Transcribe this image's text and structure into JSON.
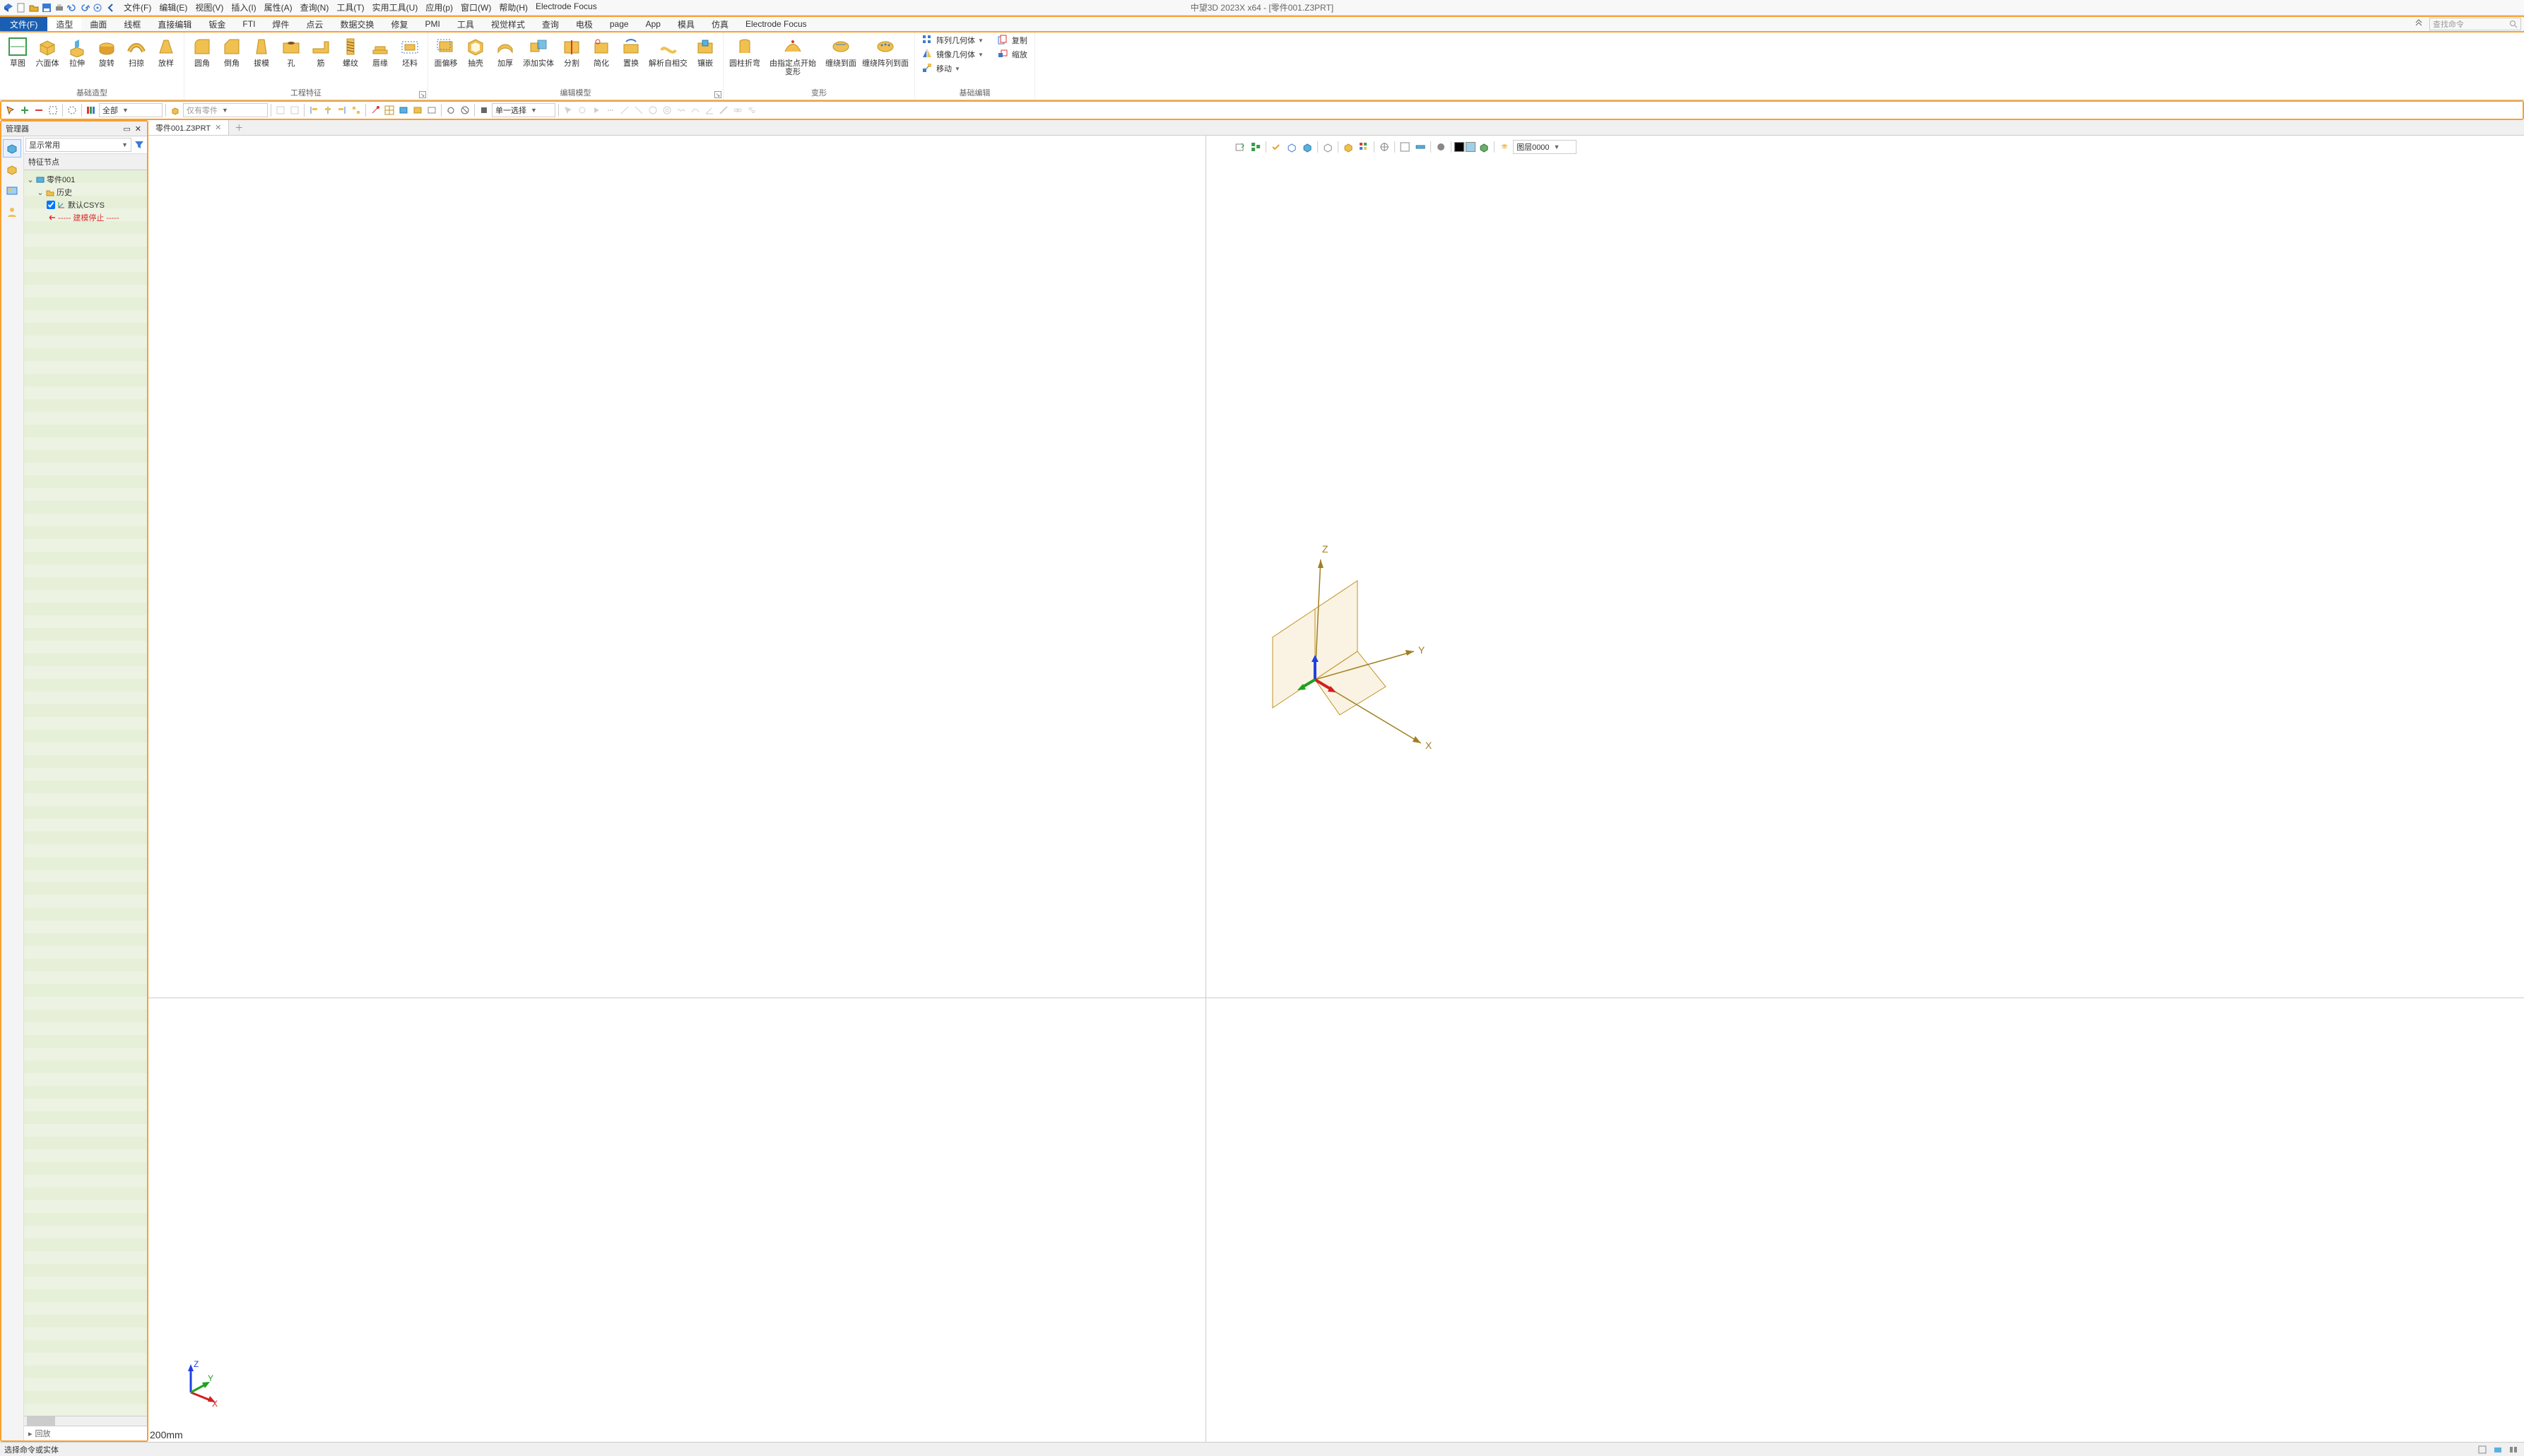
{
  "titlebar": {
    "app_title": "中望3D 2023X x64 - [零件001.Z3PRT]",
    "menus": [
      "文件(F)",
      "编辑(E)",
      "视图(V)",
      "插入(I)",
      "属性(A)",
      "查询(N)",
      "工具(T)",
      "实用工具(U)",
      "应用(p)",
      "窗口(W)",
      "帮助(H)",
      "Electrode Focus"
    ]
  },
  "ribbon": {
    "file_tab": "文件(F)",
    "tabs": [
      "造型",
      "曲面",
      "线框",
      "直接编辑",
      "钣金",
      "FTI",
      "焊件",
      "点云",
      "数据交换",
      "修复",
      "PMI",
      "工具",
      "视觉样式",
      "查询",
      "电极",
      "page",
      "App",
      "模具",
      "仿真",
      "Electrode Focus"
    ],
    "search_placeholder": "查找命令",
    "groups": {
      "shape": {
        "label": "基础造型",
        "buttons": [
          "草图",
          "六面体",
          "拉伸",
          "旋转",
          "扫掠",
          "放样"
        ]
      },
      "feature": {
        "label": "工程特征",
        "buttons": [
          "圆角",
          "倒角",
          "拔模",
          "孔",
          "筋",
          "螺纹",
          "唇缘",
          "坯料"
        ]
      },
      "edit": {
        "label": "编辑模型",
        "buttons": [
          "面偏移",
          "抽壳",
          "加厚",
          "添加实体",
          "分割",
          "简化",
          "置换",
          "解析自相交",
          "镶嵌"
        ]
      },
      "deform": {
        "label": "变形",
        "buttons": [
          "圆柱折弯",
          "由指定点开始变形",
          "缠绕到面",
          "缠绕阵列到面"
        ]
      },
      "basic_edit": {
        "label": "基础编辑",
        "rows": [
          [
            "阵列几何体",
            "复制"
          ],
          [
            "镜像几何体",
            "缩放"
          ],
          [
            "移动",
            ""
          ]
        ]
      }
    }
  },
  "toolbar2": {
    "filter1": "全部",
    "filter2": "仅有零件",
    "select_mode": "单一选择"
  },
  "left_panel": {
    "title": "管理器",
    "display_combo": "显示常用",
    "tree_header": "特征节点",
    "tree": {
      "root": "零件001",
      "history": "历史",
      "csys": "默认CSYS",
      "stop": "----- 建模停止 -----"
    },
    "playback": "回放"
  },
  "viewport": {
    "doc_tab": "零件001.Z3PRT",
    "layer_label": "图层0000",
    "scale": "200mm",
    "axes": {
      "x": "X",
      "y": "Y",
      "z": "Z"
    }
  },
  "statusbar": {
    "prompt": "选择命令或实体"
  },
  "colors": {
    "highlight_border": "#f8a030",
    "file_tab_bg": "#1a5fb4"
  }
}
